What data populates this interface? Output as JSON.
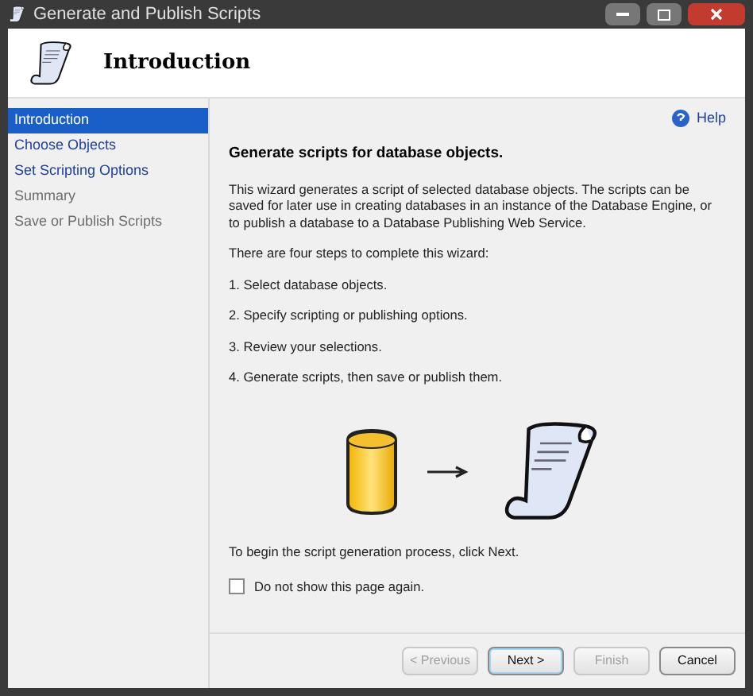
{
  "window": {
    "title": "Generate and Publish Scripts"
  },
  "header": {
    "title": "Introduction"
  },
  "sidebar": {
    "items": [
      {
        "label": "Introduction",
        "selected": true,
        "disabled": false
      },
      {
        "label": "Choose Objects",
        "selected": false,
        "disabled": false
      },
      {
        "label": "Set Scripting Options",
        "selected": false,
        "disabled": false
      },
      {
        "label": "Summary",
        "selected": false,
        "disabled": true
      },
      {
        "label": "Save or Publish Scripts",
        "selected": false,
        "disabled": true
      }
    ]
  },
  "content": {
    "help": "Help",
    "heading": "Generate scripts for database objects.",
    "description": "This wizard generates a script of selected database objects. The scripts can be saved for later use in creating databases in an instance of the Database Engine, or to publish a database to a Database Publishing Web Service.",
    "steps_intro": "There are four steps to complete this wizard:",
    "steps": [
      "1. Select database objects.",
      "2. Specify scripting or publishing options.",
      "3. Review your selections.",
      "4. Generate scripts, then save or publish them."
    ],
    "footer_text": "To begin the script generation process, click Next.",
    "checkbox": {
      "label": "Do not show this page again.",
      "checked": false
    }
  },
  "buttons": [
    {
      "label": "< Previous",
      "disabled": true,
      "default": false
    },
    {
      "label": "Next >",
      "disabled": false,
      "default": true
    },
    {
      "label": "Finish",
      "disabled": true,
      "default": false
    },
    {
      "label": "Cancel",
      "disabled": false,
      "default": false
    }
  ]
}
